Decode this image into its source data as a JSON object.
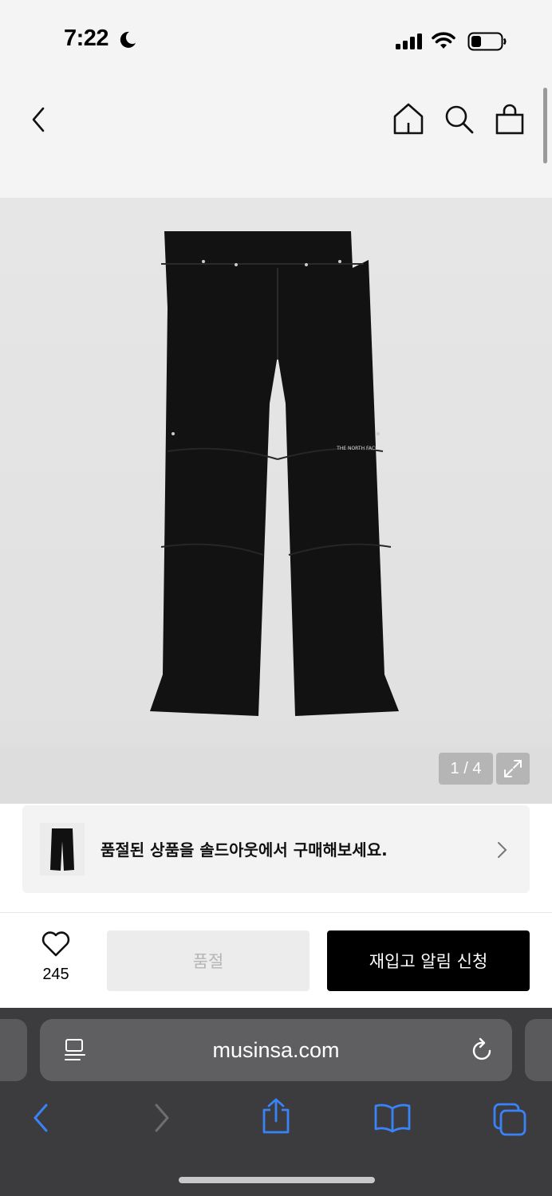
{
  "status_bar": {
    "time": "7:22"
  },
  "gallery": {
    "counter": "1 / 4"
  },
  "soldout_banner": {
    "text": "품절된 상품을 솔드아웃에서 구매해보세요."
  },
  "buy_bar": {
    "like_count": "245",
    "soldout_label": "품절",
    "restock_label": "재입고 알림 신청"
  },
  "browser": {
    "url": "musinsa.com"
  },
  "colors": {
    "accent_blue": "#3a82f7",
    "button_black": "#000000",
    "nav_bg": "#f4f4f4"
  },
  "icons": [
    "moon-icon",
    "signal-icon",
    "wifi-icon",
    "battery-icon",
    "back-icon",
    "home-icon",
    "search-icon",
    "bag-icon",
    "expand-icon",
    "chevron-right-icon",
    "heart-icon",
    "reader-icon",
    "reload-icon",
    "share-icon",
    "bookmarks-icon",
    "tabs-icon"
  ]
}
